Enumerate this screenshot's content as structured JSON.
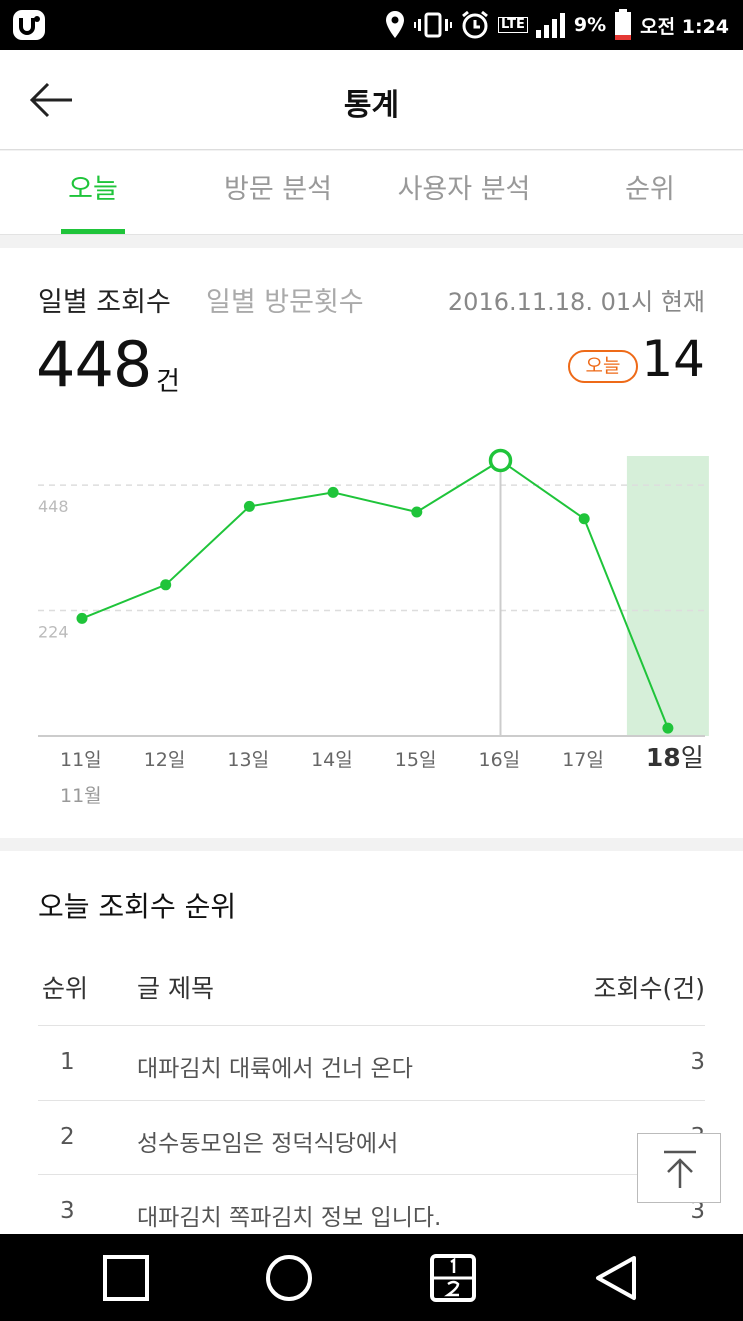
{
  "status": {
    "network": "LTE",
    "battery": "9%",
    "time": "오전 1:24",
    "battery_color": "#e53935"
  },
  "header": {
    "title": "통계",
    "back_icon": "arrow-left-icon"
  },
  "tabs": [
    {
      "label": "오늘",
      "active": true
    },
    {
      "label": "방문 분석",
      "active": false
    },
    {
      "label": "사용자 분석",
      "active": false
    },
    {
      "label": "순위",
      "active": false
    }
  ],
  "stats": {
    "subtab_active": "일별 조회수",
    "subtab_inactive": "일별 방문횟수",
    "as_of": "2016.11.18. 01시 현재",
    "total_count": "448",
    "total_unit": "건",
    "today_badge": "오늘",
    "today_count": "14"
  },
  "chart_data": {
    "type": "line",
    "x": [
      "11일",
      "12일",
      "13일",
      "14일",
      "15일",
      "16일",
      "17일",
      "18일"
    ],
    "month_label": "11월",
    "values": [
      210,
      270,
      410,
      435,
      400,
      492,
      388,
      14
    ],
    "yticks": [
      224,
      448
    ],
    "ylim": [
      0,
      500
    ],
    "grid": true,
    "highlight_index": 5,
    "today_index": 7,
    "line_color": "#1fc43a",
    "today_fill": "#d6efd9"
  },
  "ranking": {
    "title": "오늘 조회수 순위",
    "headers": {
      "rank": "순위",
      "title": "글 제목",
      "views": "조회수(건)"
    },
    "rows": [
      {
        "rank": "1",
        "title": "대파김치 대륙에서 건너 온다",
        "views": "3"
      },
      {
        "rank": "2",
        "title": "성수동모임은 정덕식당에서",
        "views": "3"
      },
      {
        "rank": "3",
        "title": "대파김치 쪽파김치 정보 입니다.",
        "views": "3"
      }
    ]
  },
  "accent": "#1fc43a",
  "badge_color": "#ee6a18"
}
